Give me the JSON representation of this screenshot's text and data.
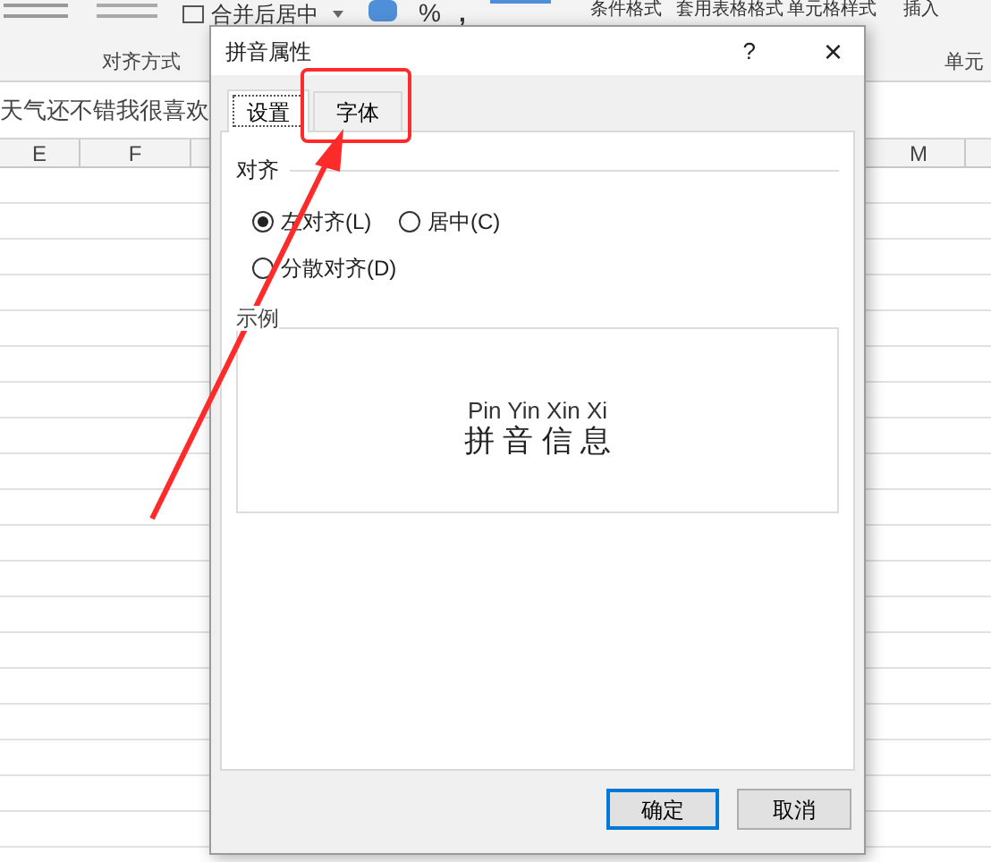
{
  "ribbon": {
    "merge_button": "合并后居中",
    "percent": "%",
    "comma": ",",
    "buttons": [
      "条件格式",
      "套用表格格式",
      "单元格样式",
      "插入"
    ],
    "groups": [
      "对齐方式",
      "单元"
    ]
  },
  "formula_bar": {
    "text": "天气还不错我很喜欢"
  },
  "columns": [
    {
      "label": "E"
    },
    {
      "label": "F"
    },
    {
      "label": "M"
    }
  ],
  "dialog": {
    "title": "拼音属性",
    "help": "?",
    "close": "×",
    "tabs": [
      {
        "label": "设置",
        "selected": true
      },
      {
        "label": "字体",
        "selected": false
      }
    ],
    "alignment": {
      "label": "对齐",
      "options": [
        {
          "label": "左对齐(L)",
          "selected": true
        },
        {
          "label": "居中(C)",
          "selected": false
        },
        {
          "label": "分散对齐(D)",
          "selected": false
        }
      ]
    },
    "preview": {
      "label": "示例",
      "pinyin": "Pin Yin Xin Xi",
      "text": "拼 音 信 息"
    },
    "buttons": [
      {
        "label": "确定",
        "default": true
      },
      {
        "label": "取消",
        "default": false
      }
    ]
  }
}
